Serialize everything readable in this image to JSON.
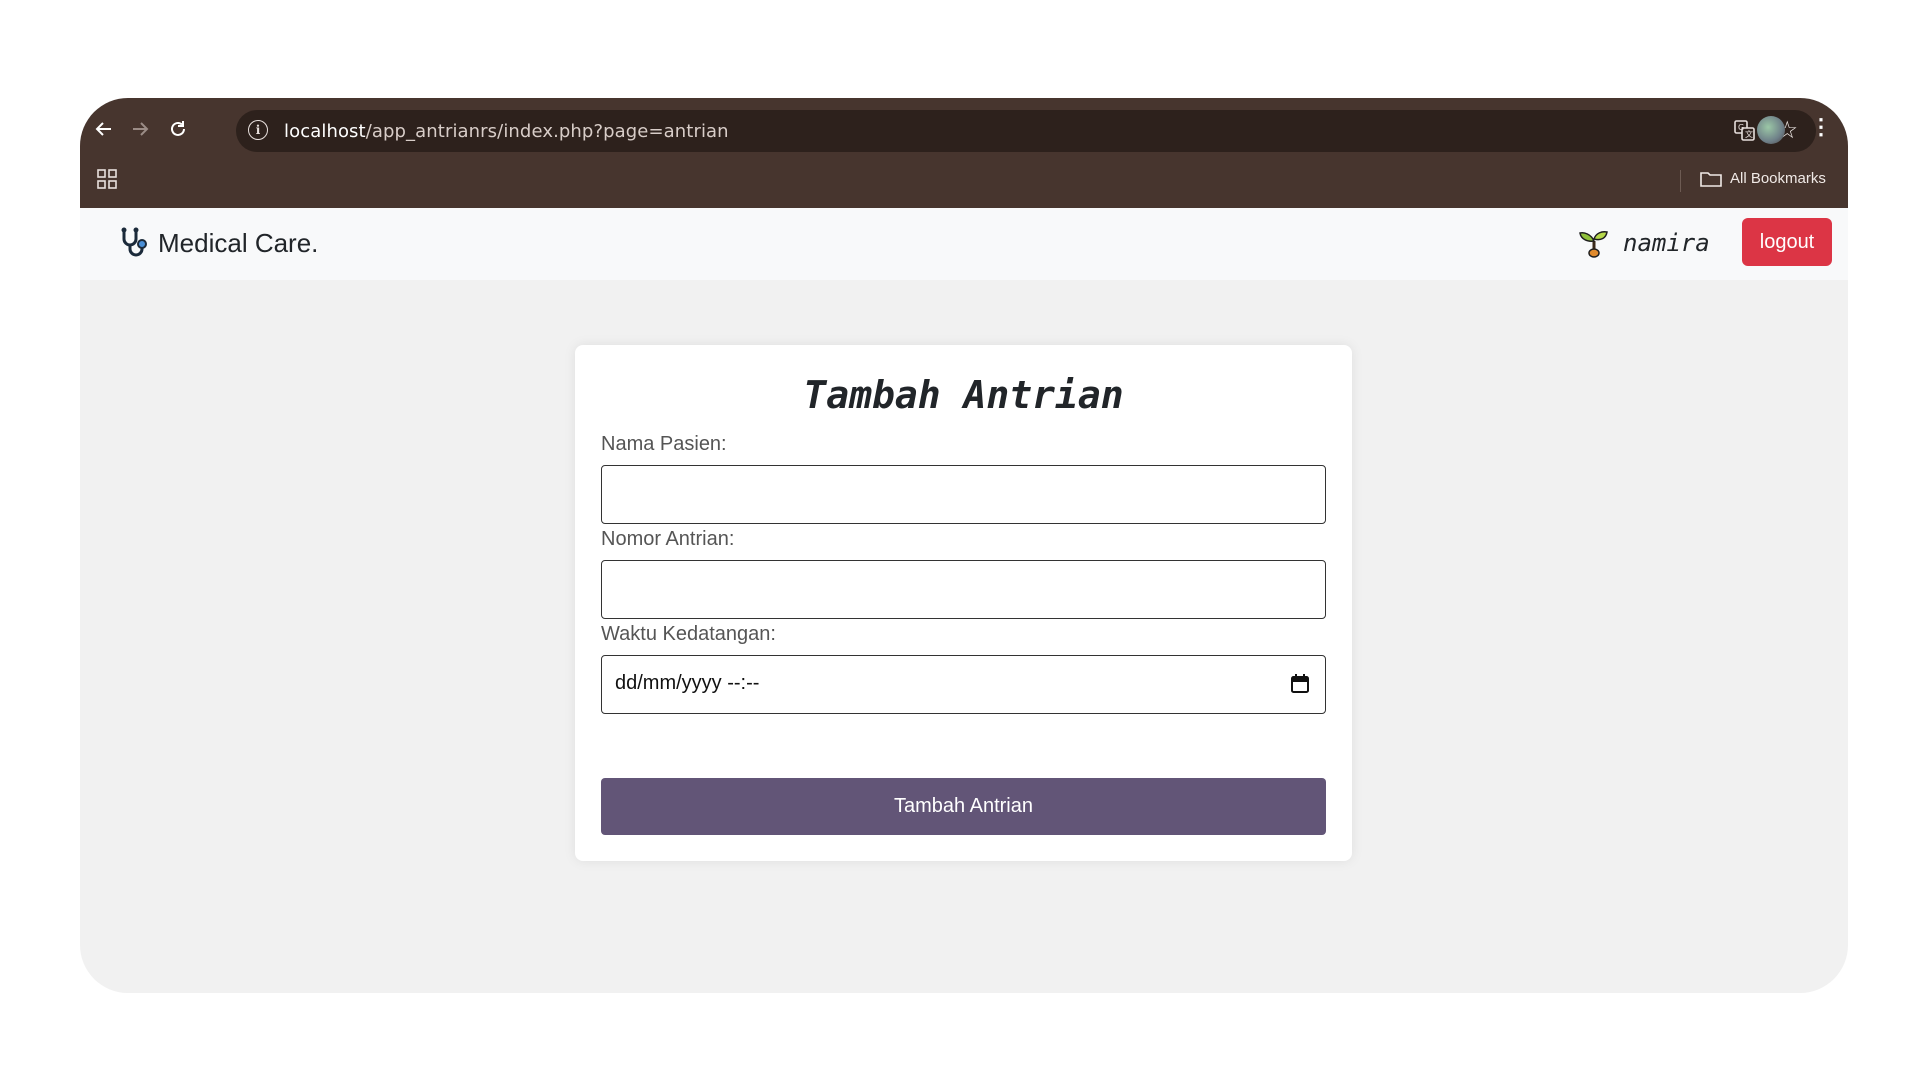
{
  "browser": {
    "url_host": "localhost",
    "url_path": "/app_antrianrs/index.php?page=antrian",
    "bookmarks_label": "All Bookmarks",
    "icons": [
      "back-arrow-icon",
      "forward-arrow-icon",
      "reload-icon",
      "site-info-icon",
      "translate-icon",
      "bookmark-star-icon",
      "profile-avatar-icon",
      "more-menu-icon",
      "apps-grid-icon",
      "folder-icon"
    ]
  },
  "navbar": {
    "brand": "Medical Care.",
    "brand_icon": "stethoscope-icon",
    "user_icon": "sprout-icon",
    "username": "namira",
    "logout_label": "logout",
    "logout_color": "#dc3545"
  },
  "form": {
    "title": "Tambah Antrian",
    "fields": [
      {
        "label": "Nama Pasien:",
        "value": ""
      },
      {
        "label": "Nomor Antrian:",
        "value": ""
      },
      {
        "label": "Waktu Kedatangan:",
        "value": "dd/mm/yyyy --:--"
      }
    ],
    "submit_label": "Tambah Antrian",
    "submit_color": "#625577"
  }
}
